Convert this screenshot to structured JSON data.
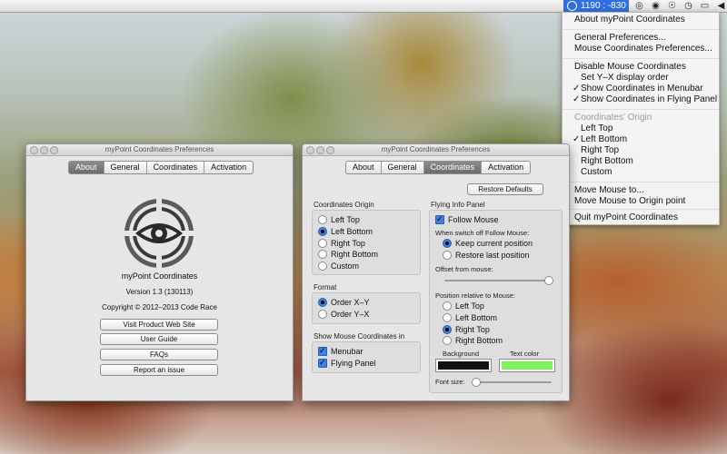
{
  "menubar": {
    "coords_text": "1190 : -830",
    "icons": [
      "target-icon",
      "circle-icon",
      "accessibility-icon",
      "time-machine-icon",
      "display-icon",
      "volume-icon"
    ]
  },
  "menu": {
    "items": [
      {
        "label": "About myPoint Coordinates"
      },
      {
        "label": "General Preferences..."
      },
      {
        "label": "Mouse Coordinates Preferences..."
      },
      {
        "label": "Disable Mouse Coordinates"
      },
      {
        "label": "Set Y–X display order"
      },
      {
        "label": "Show Coordinates in Menubar",
        "checked": true
      },
      {
        "label": "Show Coordinates in Flying Panel",
        "checked": true
      },
      {
        "label": "Coordinates' Origin",
        "disabled": true
      },
      {
        "label": "Left Top"
      },
      {
        "label": "Left Bottom",
        "checked": true
      },
      {
        "label": "Right Top"
      },
      {
        "label": "Right Bottom"
      },
      {
        "label": "Custom"
      },
      {
        "label": "Move Mouse to..."
      },
      {
        "label": "Move Mouse to Origin point"
      },
      {
        "label": "Quit myPoint Coordinates"
      }
    ],
    "check_glyph": "✓"
  },
  "win1": {
    "title": "myPoint Coordinates Preferences",
    "tabs": [
      "About",
      "General",
      "Coordinates",
      "Activation"
    ],
    "app_name": "myPoint Coordinates",
    "version": "Version 1.3 (130113)",
    "copyright": "Copyright © 2012–2013 Code Race",
    "buttons": [
      "Visit Product Web Site",
      "User Guide",
      "FAQs",
      "Report an issue"
    ]
  },
  "win2": {
    "title": "myPoint Coordinates Preferences",
    "tabs": [
      "About",
      "General",
      "Coordinates",
      "Activation"
    ],
    "restore": "Restore Defaults",
    "origin_label": "Coordinates Origin",
    "origin_opts": [
      "Left Top",
      "Left Bottom",
      "Right Top",
      "Right Bottom",
      "Custom"
    ],
    "origin_selected": 1,
    "format_label": "Format",
    "format_opts": [
      "Order X–Y",
      "Order Y–X"
    ],
    "format_selected": 0,
    "show_label": "Show Mouse Coordinates in",
    "show_opts": [
      "Menubar",
      "Flying Panel"
    ],
    "flying_label": "Flying Info Panel",
    "follow_mouse": "Follow Mouse",
    "switch_off_label": "When switch off Follow Mouse:",
    "keep_opts": [
      "Keep current position",
      "Restore last position"
    ],
    "keep_selected": 0,
    "offset_label": "Offset from mouse:",
    "offset_value": 1.0,
    "position_label": "Position relative to Mouse:",
    "position_opts": [
      "Left Top",
      "Left Bottom",
      "Right Top",
      "Right Bottom"
    ],
    "position_selected": 2,
    "background_label": "Background",
    "text_color_label": "Text color",
    "background_color": "#111111",
    "text_color": "#7cf35a",
    "font_size_label": "Font size:",
    "font_size_value": 0.0
  }
}
